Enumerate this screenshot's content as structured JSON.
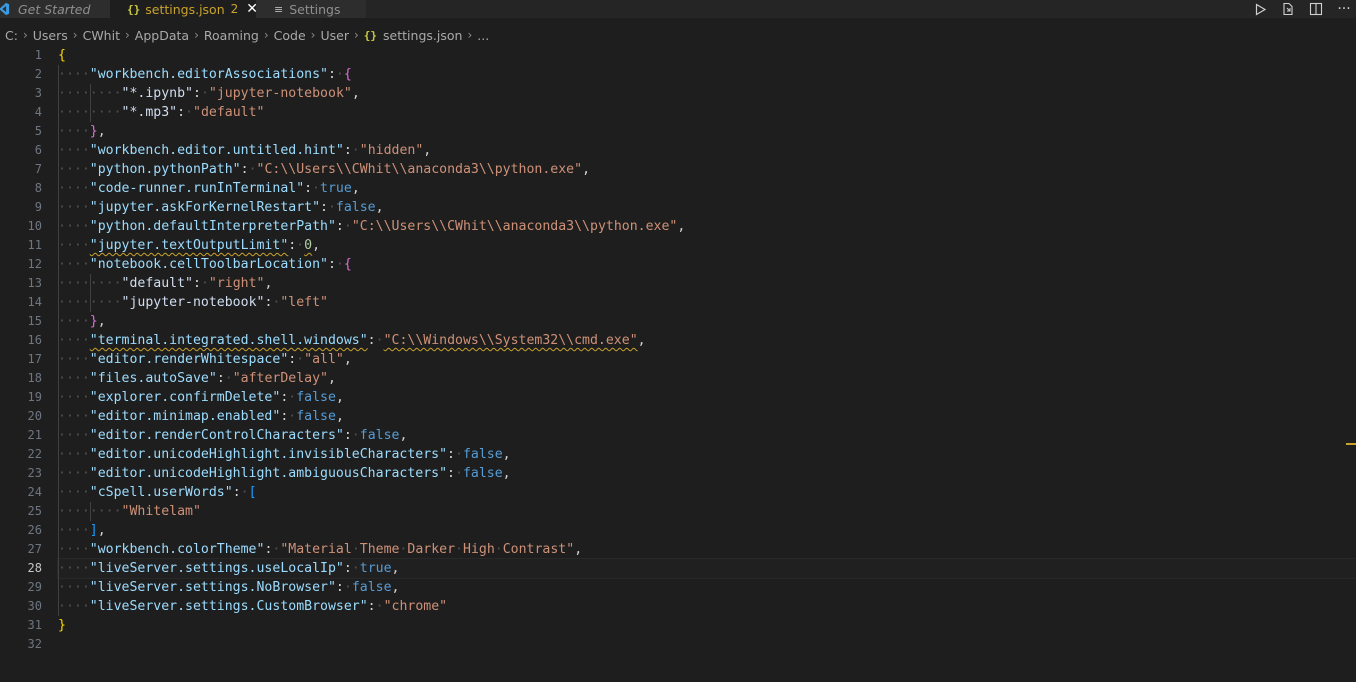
{
  "tabs": [
    {
      "label": "Get Started"
    },
    {
      "label": "settings.json",
      "count": "2"
    },
    {
      "label": "Settings"
    }
  ],
  "breadcrumb": [
    "C:",
    "Users",
    "CWhit",
    "AppData",
    "Roaming",
    "Code",
    "User",
    "settings.json",
    "..."
  ],
  "active_line": 28,
  "lines": [
    "{",
    "\"workbench.editorAssociations\": {",
    "\"*.ipynb\": \"jupyter-notebook\",",
    "\"*.mp3\": \"default\"",
    "},",
    "\"workbench.editor.untitled.hint\": \"hidden\",",
    "\"python.pythonPath\": \"C:\\\\Users\\\\CWhit\\\\anaconda3\\\\python.exe\",",
    "\"code-runner.runInTerminal\": true,",
    "\"jupyter.askForKernelRestart\": false,",
    "\"python.defaultInterpreterPath\": \"C:\\\\Users\\\\CWhit\\\\anaconda3\\\\python.exe\",",
    "\"jupyter.textOutputLimit\": 0,",
    "\"notebook.cellToolbarLocation\": {",
    "\"default\": \"right\",",
    "\"jupyter-notebook\": \"left\"",
    "},",
    "\"terminal.integrated.shell.windows\": \"C:\\\\Windows\\\\System32\\\\cmd.exe\",",
    "\"editor.renderWhitespace\": \"all\",",
    "\"files.autoSave\": \"afterDelay\",",
    "\"explorer.confirmDelete\": false,",
    "\"editor.minimap.enabled\": false,",
    "\"editor.renderControlCharacters\": false,",
    "\"editor.unicodeHighlight.invisibleCharacters\": false,",
    "\"editor.unicodeHighlight.ambiguousCharacters\": false,",
    "\"cSpell.userWords\": [",
    "\"Whitelam\"",
    "],",
    "\"workbench.colorTheme\": \"Material Theme Darker High Contrast\",",
    "\"liveServer.settings.useLocalIp\": true,",
    "\"liveServer.settings.NoBrowser\": false,",
    "\"liveServer.settings.CustomBrowser\": \"chrome\"",
    "}",
    ""
  ]
}
